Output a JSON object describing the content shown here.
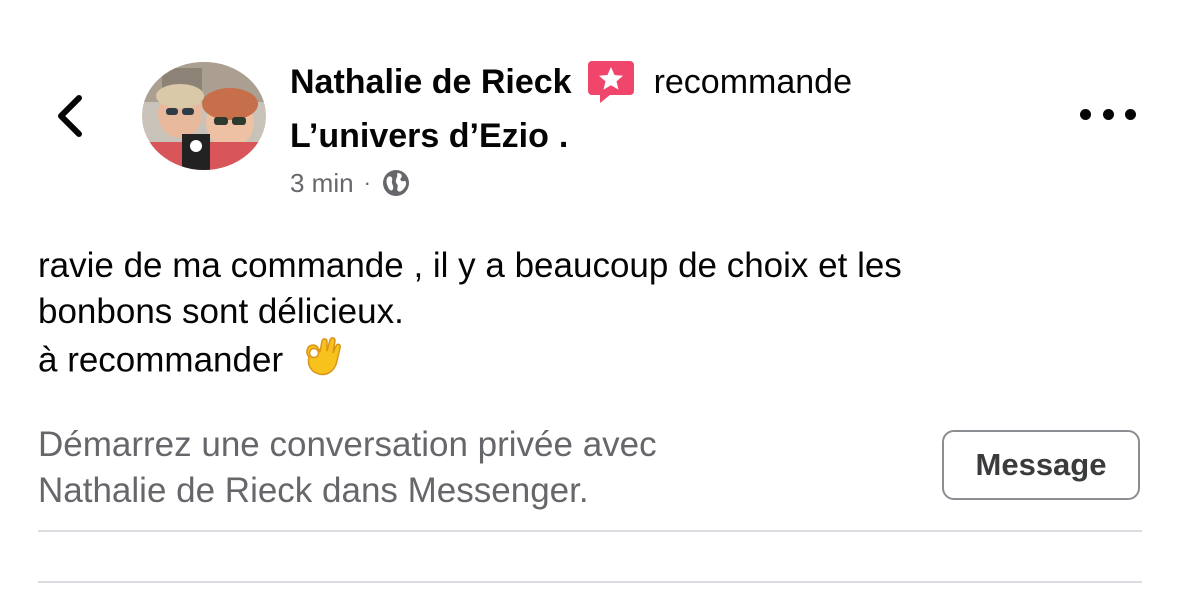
{
  "header": {
    "back_icon": "chevron-left-icon",
    "avatar_icon": "profile-photo",
    "author_name": "Nathalie de Rieck",
    "recommend_icon": "recommend-star-icon",
    "action_text": "recommande",
    "page_name": "L’univers d’Ezio",
    "page_name_suffix": ".",
    "timestamp": "3 min",
    "separator": "·",
    "audience_icon": "globe-icon",
    "more_icon": "more-horizontal-icon"
  },
  "post": {
    "lines": [
      "ravie de ma commande , il y a beaucoup de choix et les",
      "bonbons sont délicieux.",
      "à recommander"
    ],
    "emoji": "ok-hand-emoji"
  },
  "cta": {
    "lines": [
      "Démarrez une conversation privée avec",
      "Nathalie de Rieck dans Messenger."
    ],
    "button_label": "Message"
  },
  "colors": {
    "text_primary": "#050505",
    "text_secondary": "#65676b",
    "recommend_badge": "#f0466b",
    "divider": "#dadde1",
    "button_border": "#8a8d91"
  }
}
